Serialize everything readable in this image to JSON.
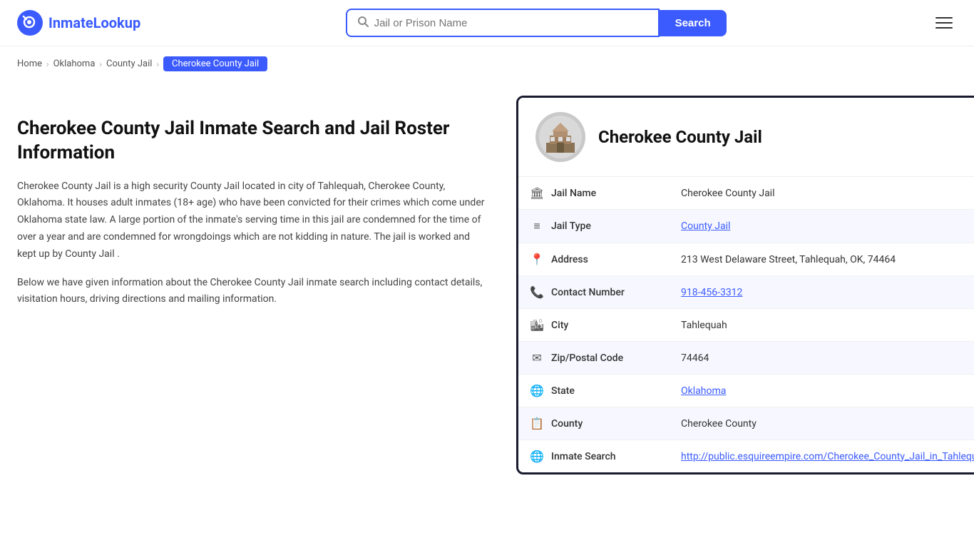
{
  "site": {
    "logo_text_1": "Inmate",
    "logo_text_2": "Lookup"
  },
  "header": {
    "search_placeholder": "Jail or Prison Name",
    "search_button_label": "Search"
  },
  "breadcrumb": {
    "items": [
      {
        "label": "Home",
        "href": "#"
      },
      {
        "label": "Oklahoma",
        "href": "#"
      },
      {
        "label": "County Jail",
        "href": "#"
      },
      {
        "label": "Cherokee County Jail",
        "current": true
      }
    ]
  },
  "left": {
    "heading": "Cherokee County Jail Inmate Search and Jail Roster Information",
    "paragraph1": "Cherokee County Jail is a high security County Jail located in city of Tahlequah, Cherokee County, Oklahoma. It houses adult inmates (18+ age) who have been convicted for their crimes which come under Oklahoma state law. A large portion of the inmate's serving time in this jail are condemned for the time of over a year and are condemned for wrongdoings which are not kidding in nature. The jail is worked and kept up by County Jail .",
    "paragraph2": "Below we have given information about the Cherokee County Jail inmate search including contact details, visitation hours, driving directions and mailing information."
  },
  "card": {
    "facility_name": "Cherokee County Jail",
    "rows": [
      {
        "icon": "🏛",
        "label": "Jail Name",
        "value": "Cherokee County Jail",
        "link": false
      },
      {
        "icon": "≡",
        "label": "Jail Type",
        "value": "County Jail",
        "link": true,
        "href": "#"
      },
      {
        "icon": "📍",
        "label": "Address",
        "value": "213 West Delaware Street, Tahlequah, OK, 74464",
        "link": false
      },
      {
        "icon": "📞",
        "label": "Contact Number",
        "value": "918-456-3312",
        "link": true,
        "href": "tel:918-456-3312"
      },
      {
        "icon": "🏙",
        "label": "City",
        "value": "Tahlequah",
        "link": false
      },
      {
        "icon": "✉",
        "label": "Zip/Postal Code",
        "value": "74464",
        "link": false
      },
      {
        "icon": "🌐",
        "label": "State",
        "value": "Oklahoma",
        "link": true,
        "href": "#"
      },
      {
        "icon": "📋",
        "label": "County",
        "value": "Cherokee County",
        "link": false
      },
      {
        "icon": "🌐",
        "label": "Inmate Search",
        "value": "http://public.esquireempire.com/Cherokee_County_Jail_in_Tahlequah",
        "link": true,
        "href": "http://public.esquireempire.com/Cherokee_County_Jail_in_Tahlequah"
      }
    ]
  },
  "menu_icon": "☰"
}
